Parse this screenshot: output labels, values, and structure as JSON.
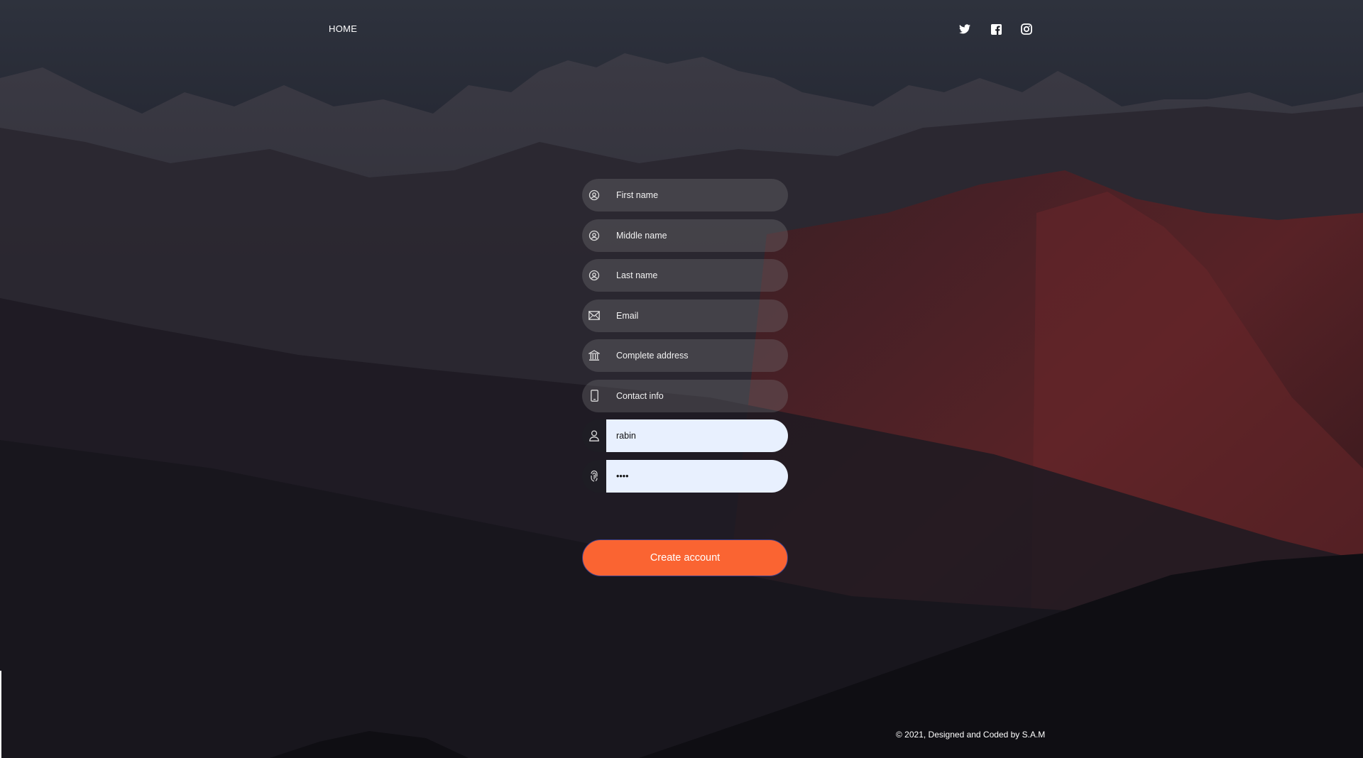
{
  "nav": {
    "home_label": "HOME",
    "social": [
      {
        "icon": "twitter-icon"
      },
      {
        "icon": "facebook-icon"
      },
      {
        "icon": "instagram-icon"
      }
    ]
  },
  "form": {
    "first_name": {
      "placeholder": "First name",
      "value": "",
      "icon": "user-circle-icon"
    },
    "middle_name": {
      "placeholder": "Middle name",
      "value": "",
      "icon": "user-circle-icon"
    },
    "last_name": {
      "placeholder": "Last name",
      "value": "",
      "icon": "user-circle-icon"
    },
    "email": {
      "placeholder": "Email",
      "value": "",
      "icon": "envelope-icon"
    },
    "address": {
      "placeholder": "Complete address",
      "value": "",
      "icon": "bank-building-icon"
    },
    "contact": {
      "placeholder": "Contact info",
      "value": "",
      "icon": "mobile-phone-icon"
    },
    "username": {
      "placeholder": "",
      "value": "rabin",
      "icon": "user-icon"
    },
    "password": {
      "placeholder": "",
      "value": "••••",
      "icon": "fingerprint-icon"
    },
    "submit_label": "Create account"
  },
  "footer": {
    "text": "© 2021, Designed and Coded by S.A.M"
  },
  "colors": {
    "accent": "#fa6432",
    "autofill": "#e8f0fe",
    "field_bg": "rgba(120,120,125,0.32)"
  }
}
